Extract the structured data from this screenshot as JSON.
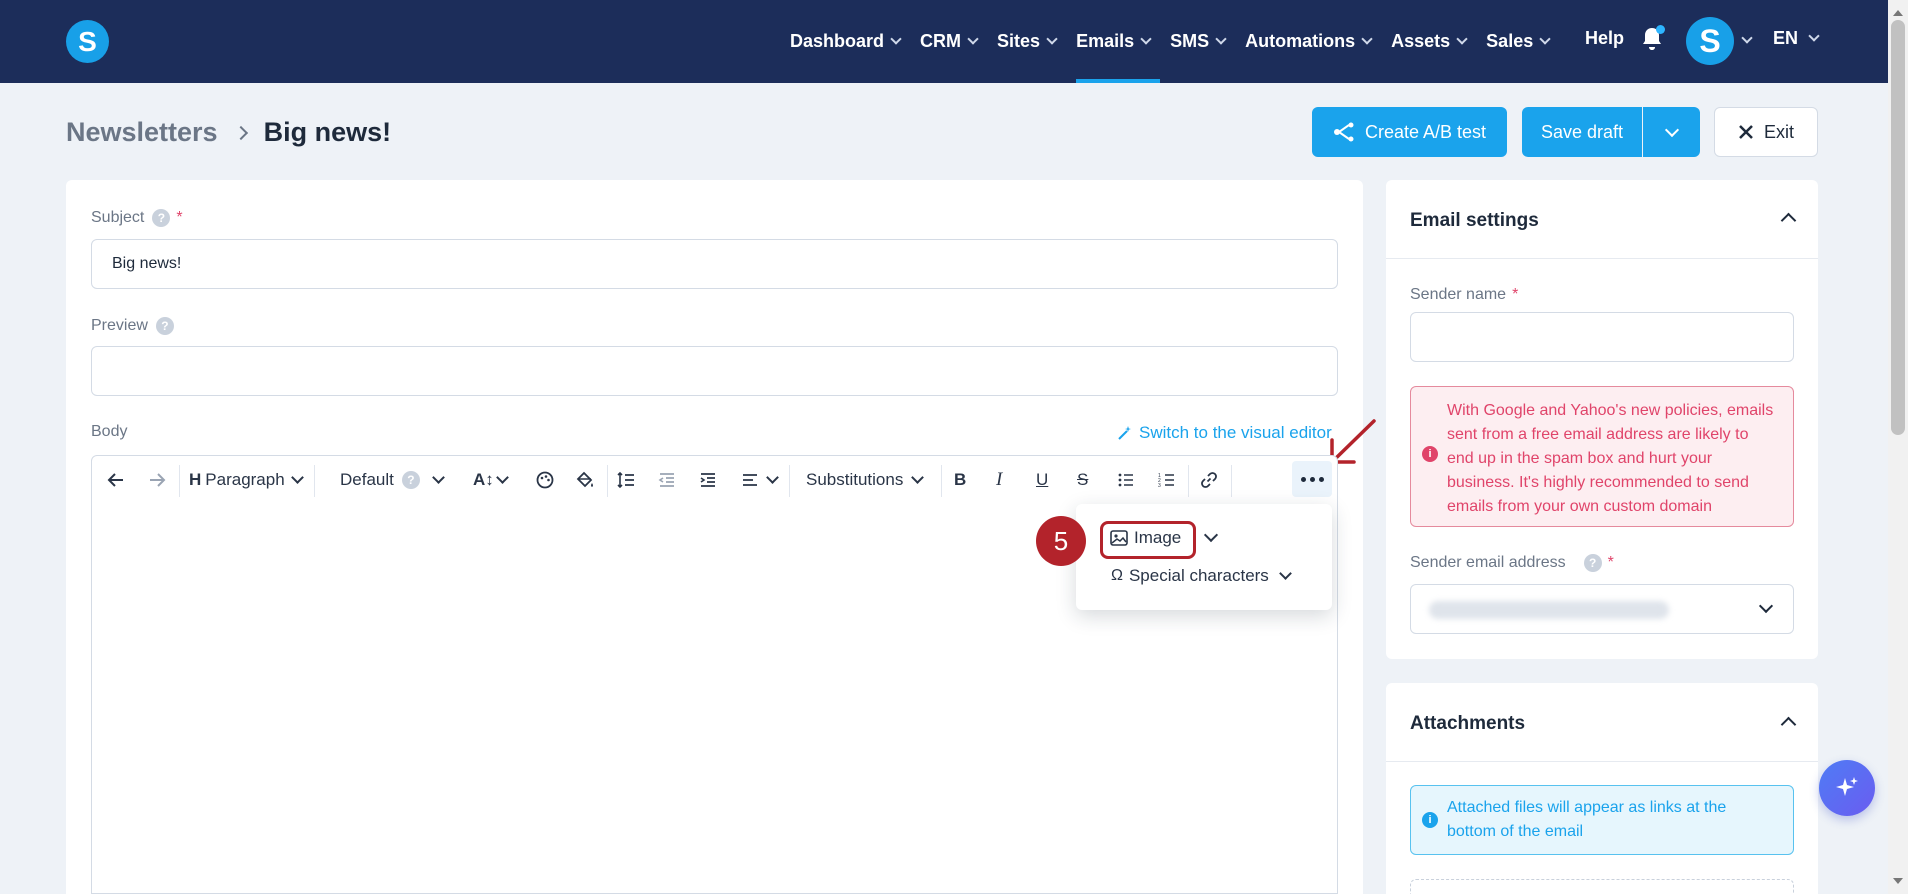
{
  "app": {
    "logo_letter": "S"
  },
  "nav": {
    "items": [
      {
        "label": "Dashboard"
      },
      {
        "label": "CRM"
      },
      {
        "label": "Sites"
      },
      {
        "label": "Emails"
      },
      {
        "label": "SMS"
      },
      {
        "label": "Automations"
      },
      {
        "label": "Assets"
      },
      {
        "label": "Sales"
      }
    ],
    "active": "Emails",
    "help_label": "Help",
    "avatar_letter": "S",
    "language": "EN"
  },
  "header": {
    "breadcrumb_parent": "Newsletters",
    "breadcrumb_current": "Big news!",
    "ab_test_label": "Create A/B test",
    "save_draft_label": "Save draft",
    "exit_label": "Exit"
  },
  "form": {
    "subject_label": "Subject",
    "subject_value": "Big news!",
    "preview_label": "Preview",
    "preview_value": "",
    "body_label": "Body",
    "switch_editor_label": "Switch to the visual editor"
  },
  "toolbar": {
    "paragraph_label": "Paragraph",
    "font_label": "Default",
    "substitutions_label": "Substitutions"
  },
  "more_menu": {
    "image_label": "Image",
    "special_chars_label": "Special characters",
    "step_number": "5"
  },
  "email_settings": {
    "title": "Email settings",
    "sender_name_label": "Sender name",
    "sender_name_value": "",
    "warning_text": "With Google and Yahoo's new policies, emails sent from a free email address are likely to end up in the spam box and hurt your business. It's highly recommended to send emails from your own custom domain",
    "sender_email_label": "Sender email address"
  },
  "attachments": {
    "title": "Attachments",
    "info_text": "Attached files will appear as links at the bottom of the email"
  },
  "colors": {
    "nav_bg": "#1c2d5a",
    "accent": "#1aa3ec",
    "warning": "#e0446a",
    "step_marker": "#b3232b"
  }
}
